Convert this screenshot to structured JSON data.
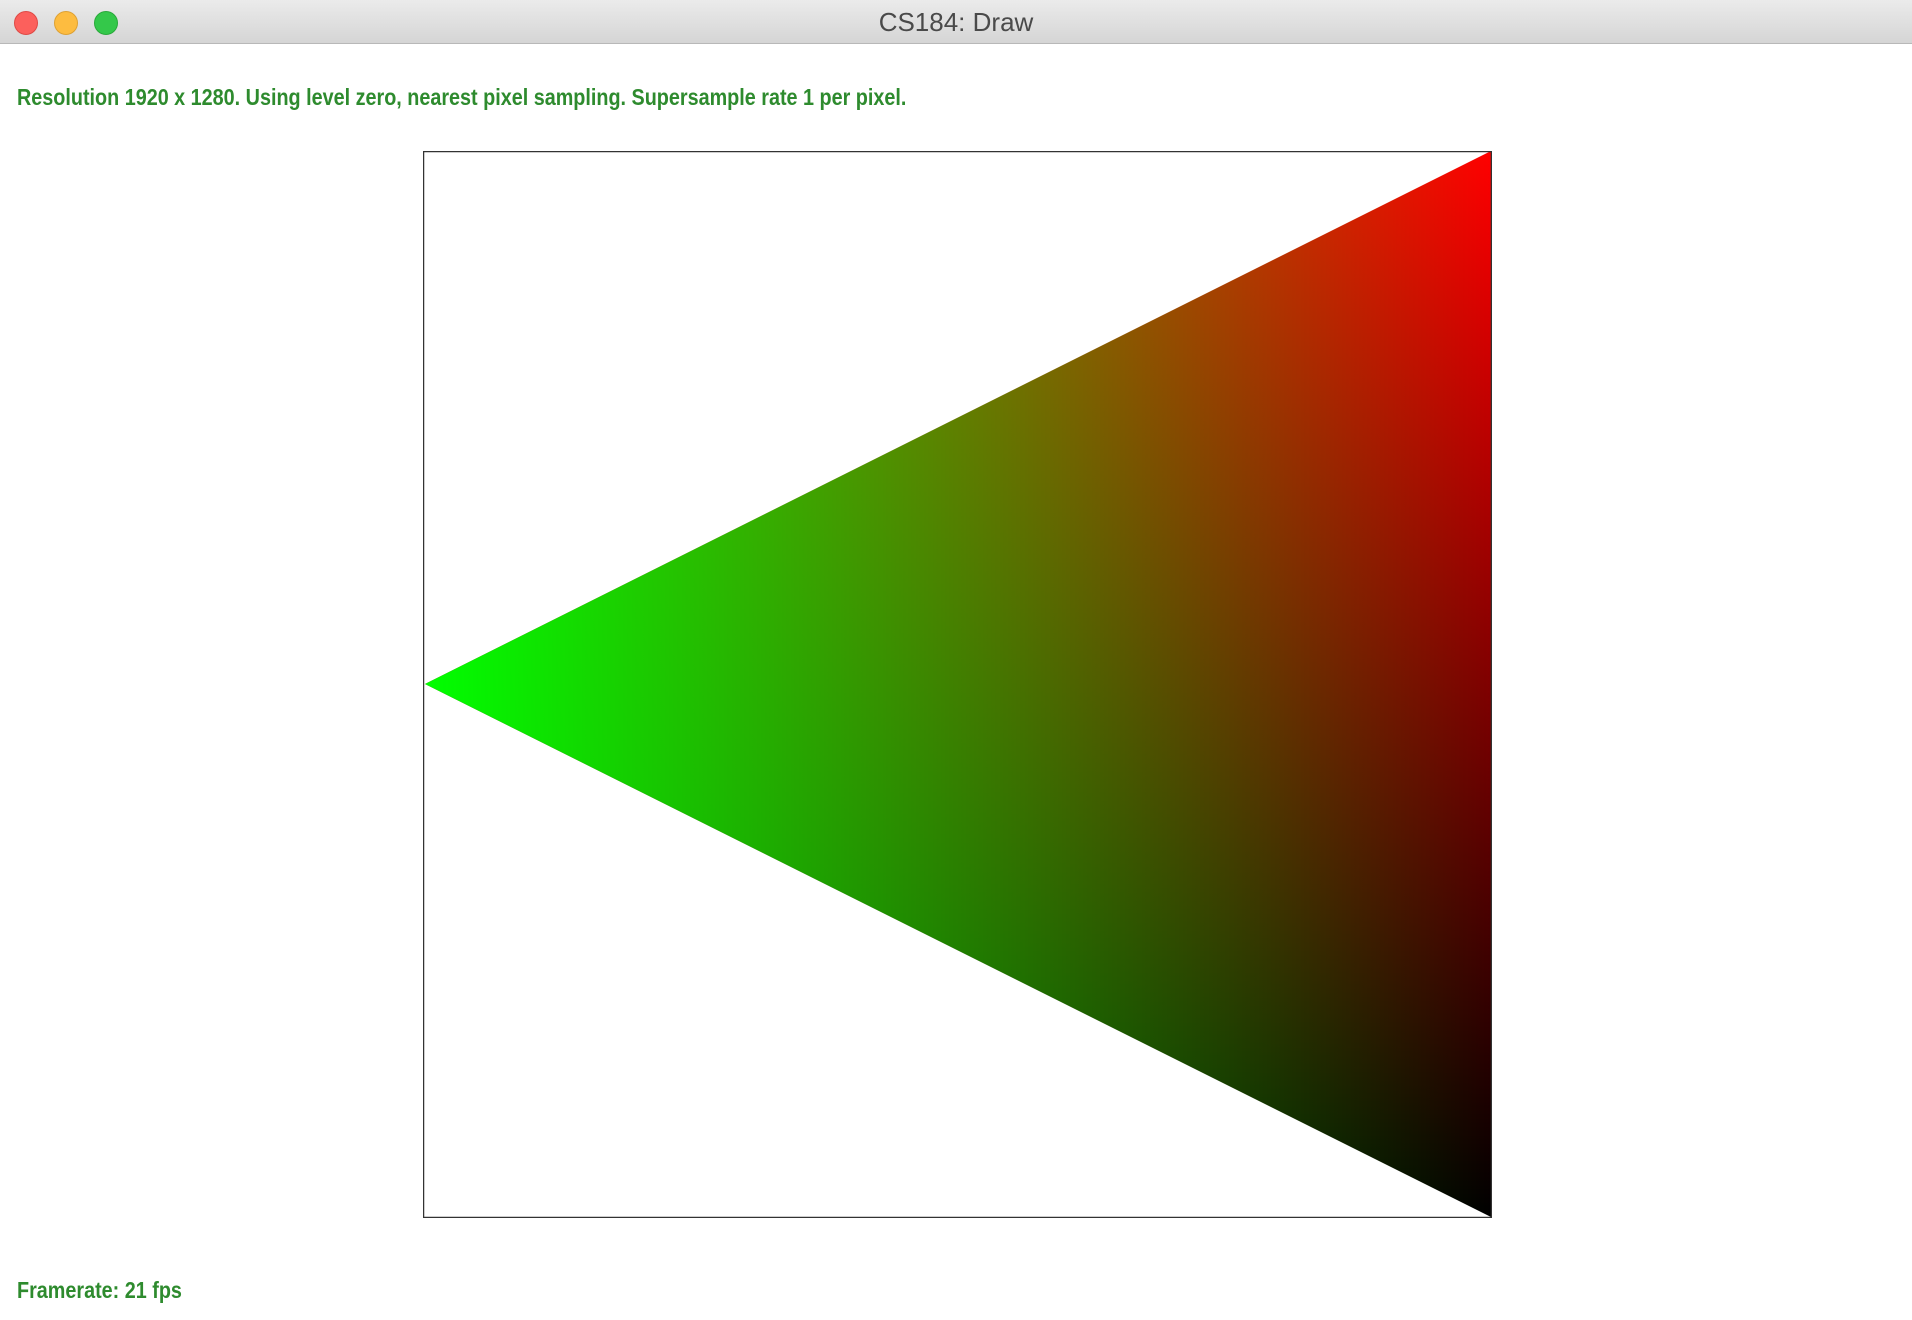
{
  "window": {
    "title": "CS184: Draw",
    "buttons": {
      "close": "close",
      "minimize": "minimize",
      "zoom": "zoom"
    }
  },
  "status": {
    "info_text": "Resolution 1920 x 1280. Using level zero, nearest pixel sampling. Supersample rate 1 per pixel.",
    "framerate_text": "Framerate: 21 fps",
    "text_color": "#2e8b2e"
  },
  "scene": {
    "triangle_vertex_colors": {
      "top_right": "#ff0000",
      "left": "#00ff00",
      "bottom_right": "#000000"
    },
    "frame_border_color": "#333333"
  }
}
